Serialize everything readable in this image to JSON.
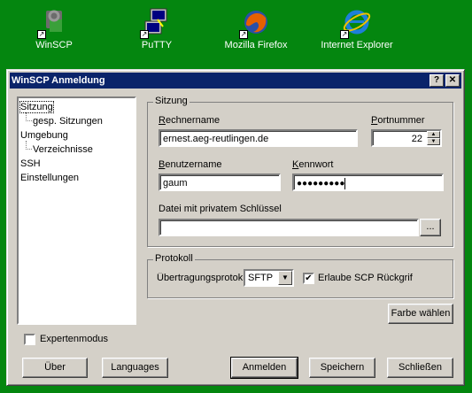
{
  "desktop": {
    "icons": [
      {
        "label": "WinSCP",
        "icon": "winscp-icon"
      },
      {
        "label": "PuTTY",
        "icon": "putty-icon"
      },
      {
        "label": "Mozilla Firefox",
        "icon": "firefox-icon"
      },
      {
        "label": "Internet Explorer",
        "icon": "ie-icon"
      }
    ]
  },
  "dialog": {
    "title": "WinSCP Anmeldung",
    "help_btn": "?",
    "close_btn": "✕",
    "tree": [
      {
        "label": "Sitzung",
        "selected": true
      },
      {
        "label": "gesp. Sitzungen"
      },
      {
        "label": "Umgebung"
      },
      {
        "label": "Verzeichnisse"
      },
      {
        "label": "SSH"
      },
      {
        "label": "Einstellungen"
      }
    ],
    "session": {
      "group_label": "Sitzung",
      "host_label_u": "R",
      "host_label_rest": "echnername",
      "host_value": "ernest.aeg-reutlingen.de",
      "port_label_u": "P",
      "port_label_rest": "ortnummer",
      "port_value": "22",
      "user_label_u": "B",
      "user_label_rest": "enutzername",
      "user_value": "gaum",
      "pass_label_u": "K",
      "pass_label_rest": "ennwort",
      "pass_value": "●●●●●●●●●",
      "keyfile_label": "Datei mit privatem Schlüssel",
      "keyfile_value": "",
      "browse_btn": "..."
    },
    "protocol": {
      "group_label": "Protokoll",
      "transfer_label": "Übertragungsprotok",
      "transfer_value": "SFTP",
      "scp_label": "Erlaube SCP Rückgrif",
      "scp_checked": "✔"
    },
    "color_btn": "Farbe wählen",
    "expert_label": "Expertenmodus",
    "buttons": {
      "about": "Über",
      "languages": "Languages",
      "login": "Anmelden",
      "save": "Speichern",
      "close": "Schließen"
    }
  }
}
